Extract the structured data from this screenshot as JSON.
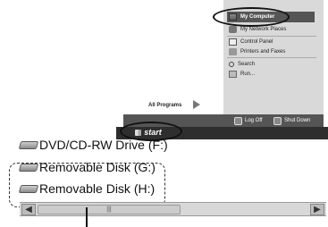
{
  "start_menu": {
    "right_items": [
      {
        "label": "My Computer",
        "icon": "computer-icon"
      },
      {
        "label": "My Network Places",
        "icon": "network-icon"
      },
      {
        "label": "Control Panel",
        "icon": "control-panel-icon"
      },
      {
        "label": "Printers and Faxes",
        "icon": "printer-icon"
      },
      {
        "label": "Search",
        "icon": "search-icon"
      },
      {
        "label": "Run...",
        "icon": "run-icon"
      }
    ],
    "all_programs": "All Programs",
    "log_off": "Log Off",
    "shut_down": "Shut Down"
  },
  "taskbar": {
    "start_label": "start"
  },
  "explorer": {
    "items": [
      {
        "label": "DVD/CD-RW Drive (F:)"
      },
      {
        "label": "Removable Disk (G:)"
      },
      {
        "label": "Removable Disk (H:)"
      }
    ],
    "scrollbar_grip": "|||"
  },
  "colors": {
    "taskbar": "#2e2e2e",
    "menu_highlight": "#555555",
    "menu_right_pane": "#d9d9d9"
  }
}
